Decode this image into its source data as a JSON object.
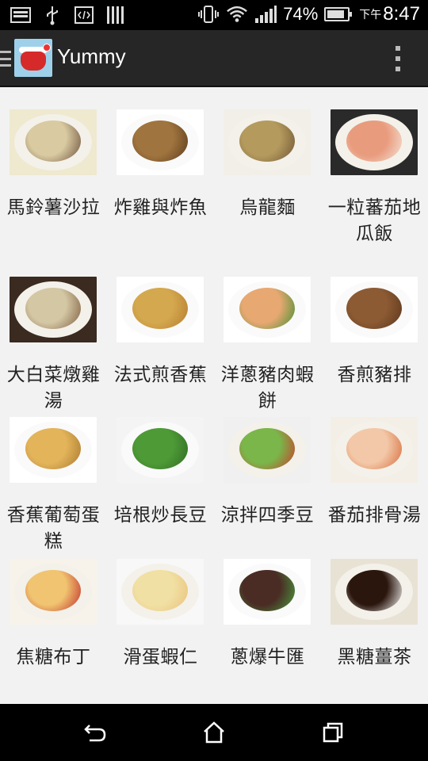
{
  "status_bar": {
    "battery_percent": "74%",
    "battery_level": 0.74,
    "time_prefix": "下午",
    "time": "8:47",
    "left_icons": [
      "notification-image-icon",
      "usb-icon",
      "code-icon",
      "barcode-icon"
    ],
    "right_icons": [
      "vibrate-icon",
      "wifi-icon",
      "signal-icon",
      "battery-charging-icon"
    ]
  },
  "action_bar": {
    "title": "Yummy",
    "icons": [
      "drawer-icon",
      "app-logo-icon",
      "overflow-menu-icon"
    ]
  },
  "recipes": [
    {
      "name": "馬鈴薯沙拉",
      "image": "potato-salad"
    },
    {
      "name": "炸雞與炸魚",
      "image": "fried-chicken-fish"
    },
    {
      "name": "烏龍麵",
      "image": "udon"
    },
    {
      "name": "一粒蕃茄地瓜飯",
      "image": "tomato-sweet-potato-rice"
    },
    {
      "name": "大白菜燉雞湯",
      "image": "cabbage-chicken-soup"
    },
    {
      "name": "法式煎香蕉",
      "image": "french-fried-banana"
    },
    {
      "name": "洋蔥豬肉蝦餅",
      "image": "onion-pork-shrimp-cake"
    },
    {
      "name": "香煎豬排",
      "image": "pan-fried-pork-chop"
    },
    {
      "name": "香蕉葡萄蛋糕",
      "image": "banana-grape-cake"
    },
    {
      "name": "培根炒長豆",
      "image": "bacon-long-beans"
    },
    {
      "name": "涼拌四季豆",
      "image": "cold-green-beans"
    },
    {
      "name": "番茄排骨湯",
      "image": "tomato-rib-soup"
    },
    {
      "name": "焦糖布丁",
      "image": "caramel-pudding"
    },
    {
      "name": "滑蛋蝦仁",
      "image": "egg-shrimp"
    },
    {
      "name": "蔥爆牛匯",
      "image": "scallion-beef"
    },
    {
      "name": "黑糖薑茶",
      "image": "brown-sugar-ginger-tea"
    }
  ],
  "nav_bar": {
    "icons": [
      "back-icon",
      "home-icon",
      "recents-icon"
    ]
  },
  "colors": {
    "status_bar_bg": "#000000",
    "action_bar_bg": "#262626",
    "content_bg": "#f2f2f2",
    "label_text": "#222222"
  }
}
